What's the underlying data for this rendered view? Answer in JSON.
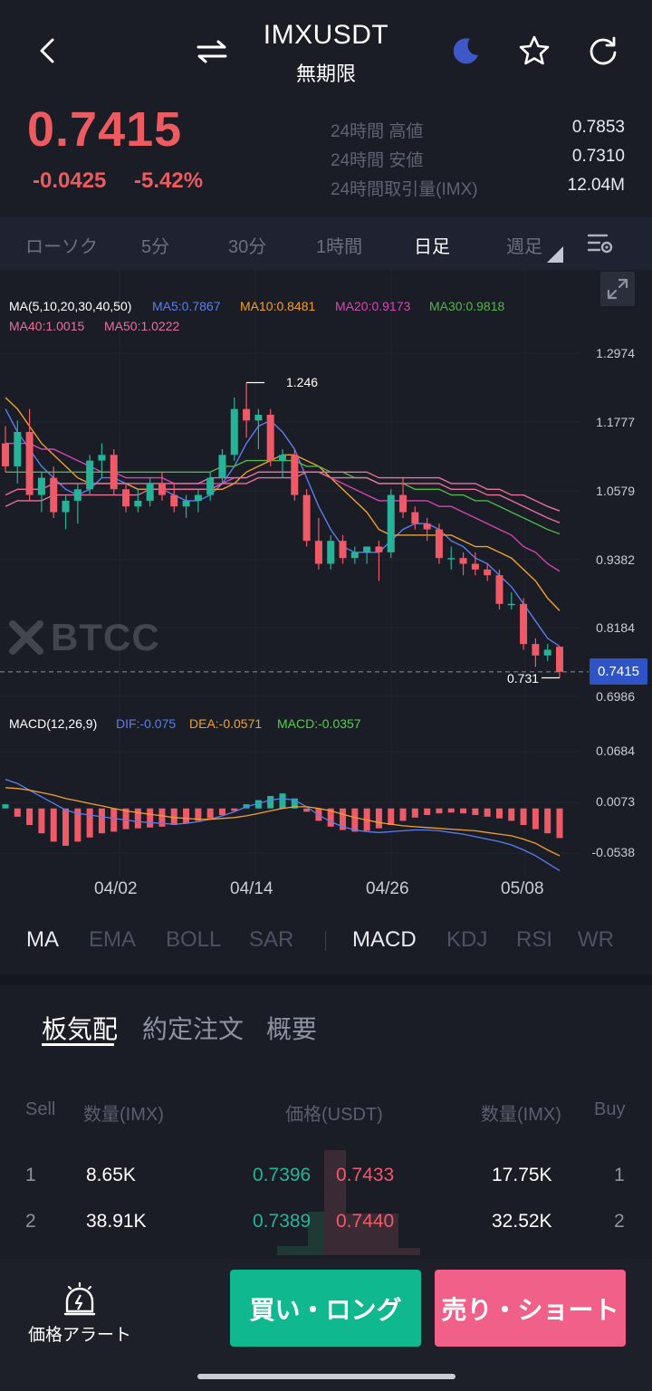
{
  "header": {
    "title": "IMXUSDT",
    "subtitle": "無期限"
  },
  "ticker": {
    "price": "0.7415",
    "change": "-0.0425",
    "change_pct": "-5.42%",
    "stats": [
      {
        "label": "24時間 高値",
        "value": "0.7853"
      },
      {
        "label": "24時間 安値",
        "value": "0.7310"
      },
      {
        "label": "24時間取引量(IMX)",
        "value": "12.04M"
      }
    ]
  },
  "timeframes": [
    "ローソク",
    "5分",
    "30分",
    "1時間",
    "日足",
    "週足"
  ],
  "active_timeframe": "日足",
  "ma_legend": {
    "title": "MA(5,10,20,30,40,50)",
    "items": [
      {
        "label": "MA5:0.7867",
        "color": "#5b7df0"
      },
      {
        "label": "MA10:0.8481",
        "color": "#f0a033"
      },
      {
        "label": "MA20:0.9173",
        "color": "#d645b4"
      },
      {
        "label": "MA30:0.9818",
        "color": "#53b54a"
      },
      {
        "label": "MA40:1.0015",
        "color": "#e8709b"
      },
      {
        "label": "MA50:1.0222",
        "color": "#e8709b"
      }
    ]
  },
  "watermark": "BTCC",
  "price_axis": [
    "1.2974",
    "1.1777",
    "1.0579",
    "0.9382",
    "0.8184",
    "0.6986"
  ],
  "current_price_tag": "0.7415",
  "high_marker": "1.246",
  "low_marker": "0.731",
  "macd_legend": {
    "title": "MACD(12,26,9)",
    "dif": "DIF:-0.075",
    "dea": "DEA:-0.0571",
    "macd": "MACD:-0.0357"
  },
  "macd_axis": [
    "0.0684",
    "0.0073",
    "-0.0538"
  ],
  "date_axis": [
    "04/02",
    "04/14",
    "04/26",
    "05/08"
  ],
  "indicators_main": [
    "MA",
    "EMA",
    "BOLL",
    "SAR"
  ],
  "indicators_sub": [
    "MACD",
    "KDJ",
    "RSI",
    "WR"
  ],
  "orderbook": {
    "tabs": [
      "板気配",
      "約定注文",
      "概要"
    ],
    "headers": {
      "sell": "Sell",
      "qty_left": "数量(IMX)",
      "price": "価格(USDT)",
      "qty_right": "数量(IMX)",
      "buy": "Buy"
    },
    "rows": [
      {
        "idx": "1",
        "bid_qty": "8.65K",
        "bid_price": "0.7396",
        "ask_price": "0.7433",
        "ask_qty": "17.75K",
        "idx_r": "1"
      },
      {
        "idx": "2",
        "bid_qty": "38.91K",
        "bid_price": "0.7389",
        "ask_price": "0.7440",
        "ask_qty": "32.52K",
        "idx_r": "2"
      }
    ]
  },
  "footer": {
    "alert_label": "価格アラート",
    "buy_label": "買い・ロング",
    "sell_label": "売り・ショート"
  },
  "colors": {
    "up": "#26b39a",
    "down": "#ef5a68",
    "buy_button": "#0fb88f",
    "sell_button": "#f06088"
  },
  "chart_data": {
    "type": "candlestick",
    "price_range": [
      0.6986,
      1.2974
    ],
    "candles": [
      [
        1.14,
        1.17,
        1.09,
        1.1
      ],
      [
        1.1,
        1.18,
        1.07,
        1.16
      ],
      [
        1.16,
        1.2,
        1.04,
        1.05
      ],
      [
        1.05,
        1.09,
        1.02,
        1.08
      ],
      [
        1.08,
        1.1,
        1.01,
        1.02
      ],
      [
        1.02,
        1.05,
        0.99,
        1.04
      ],
      [
        1.04,
        1.07,
        1.0,
        1.06
      ],
      [
        1.06,
        1.12,
        1.05,
        1.11
      ],
      [
        1.11,
        1.14,
        1.08,
        1.12
      ],
      [
        1.12,
        1.13,
        1.05,
        1.06
      ],
      [
        1.06,
        1.07,
        1.02,
        1.03
      ],
      [
        1.03,
        1.06,
        1.02,
        1.04
      ],
      [
        1.04,
        1.08,
        1.03,
        1.07
      ],
      [
        1.07,
        1.09,
        1.04,
        1.05
      ],
      [
        1.05,
        1.07,
        1.02,
        1.03
      ],
      [
        1.03,
        1.05,
        1.01,
        1.04
      ],
      [
        1.04,
        1.06,
        1.02,
        1.05
      ],
      [
        1.05,
        1.09,
        1.04,
        1.08
      ],
      [
        1.08,
        1.13,
        1.07,
        1.12
      ],
      [
        1.12,
        1.22,
        1.11,
        1.2
      ],
      [
        1.2,
        1.246,
        1.15,
        1.18
      ],
      [
        1.18,
        1.2,
        1.13,
        1.19
      ],
      [
        1.19,
        1.2,
        1.1,
        1.11
      ],
      [
        1.11,
        1.13,
        1.08,
        1.12
      ],
      [
        1.12,
        1.13,
        1.04,
        1.05
      ],
      [
        1.05,
        1.06,
        0.96,
        0.97
      ],
      [
        0.97,
        1.01,
        0.92,
        0.93
      ],
      [
        0.93,
        0.98,
        0.92,
        0.97
      ],
      [
        0.97,
        0.98,
        0.93,
        0.94
      ],
      [
        0.94,
        0.96,
        0.93,
        0.95
      ],
      [
        0.95,
        0.96,
        0.93,
        0.96
      ],
      [
        0.96,
        0.97,
        0.9,
        0.95
      ],
      [
        0.95,
        1.06,
        0.94,
        1.05
      ],
      [
        1.05,
        1.08,
        1.01,
        1.02
      ],
      [
        1.02,
        1.03,
        0.99,
        1.0
      ],
      [
        1.0,
        1.01,
        0.97,
        0.99
      ],
      [
        0.99,
        1.0,
        0.93,
        0.94
      ],
      [
        0.94,
        0.96,
        0.92,
        0.94
      ],
      [
        0.94,
        0.95,
        0.91,
        0.93
      ],
      [
        0.93,
        0.95,
        0.91,
        0.92
      ],
      [
        0.92,
        0.93,
        0.9,
        0.91
      ],
      [
        0.91,
        0.92,
        0.85,
        0.86
      ],
      [
        0.86,
        0.88,
        0.85,
        0.86
      ],
      [
        0.86,
        0.87,
        0.78,
        0.79
      ],
      [
        0.79,
        0.8,
        0.75,
        0.77
      ],
      [
        0.77,
        0.79,
        0.76,
        0.78
      ],
      [
        0.7853,
        0.7853,
        0.731,
        0.7415
      ]
    ],
    "series": [
      {
        "name": "MA5",
        "values": [
          1.2,
          1.16,
          1.13,
          1.1,
          1.08,
          1.06,
          1.05,
          1.06,
          1.08,
          1.08,
          1.07,
          1.06,
          1.06,
          1.06,
          1.05,
          1.04,
          1.04,
          1.05,
          1.07,
          1.1,
          1.14,
          1.17,
          1.18,
          1.16,
          1.13,
          1.08,
          1.03,
          0.99,
          0.96,
          0.95,
          0.95,
          0.95,
          0.97,
          0.99,
          1.0,
          1.0,
          0.99,
          0.97,
          0.96,
          0.94,
          0.93,
          0.91,
          0.89,
          0.86,
          0.83,
          0.8,
          0.786
        ]
      },
      {
        "name": "MA10",
        "values": [
          1.22,
          1.2,
          1.17,
          1.14,
          1.12,
          1.1,
          1.08,
          1.07,
          1.07,
          1.07,
          1.07,
          1.06,
          1.06,
          1.06,
          1.06,
          1.06,
          1.06,
          1.06,
          1.06,
          1.07,
          1.09,
          1.1,
          1.11,
          1.12,
          1.12,
          1.11,
          1.1,
          1.08,
          1.06,
          1.04,
          1.02,
          0.99,
          0.98,
          0.98,
          0.98,
          0.98,
          0.98,
          0.98,
          0.97,
          0.96,
          0.96,
          0.95,
          0.94,
          0.92,
          0.9,
          0.87,
          0.848
        ]
      },
      {
        "name": "MA20",
        "values": [
          1.14,
          1.14,
          1.14,
          1.13,
          1.13,
          1.12,
          1.11,
          1.1,
          1.09,
          1.09,
          1.08,
          1.08,
          1.08,
          1.08,
          1.07,
          1.07,
          1.07,
          1.07,
          1.07,
          1.08,
          1.08,
          1.09,
          1.09,
          1.09,
          1.09,
          1.09,
          1.09,
          1.08,
          1.07,
          1.06,
          1.05,
          1.04,
          1.04,
          1.04,
          1.04,
          1.04,
          1.03,
          1.03,
          1.02,
          1.01,
          1.0,
          0.99,
          0.98,
          0.96,
          0.95,
          0.93,
          0.917
        ]
      },
      {
        "name": "MA30",
        "values": [
          1.09,
          1.09,
          1.09,
          1.09,
          1.09,
          1.09,
          1.09,
          1.09,
          1.09,
          1.09,
          1.09,
          1.09,
          1.09,
          1.09,
          1.09,
          1.09,
          1.09,
          1.09,
          1.1,
          1.1,
          1.11,
          1.11,
          1.11,
          1.11,
          1.11,
          1.1,
          1.1,
          1.09,
          1.09,
          1.08,
          1.08,
          1.07,
          1.07,
          1.07,
          1.06,
          1.06,
          1.06,
          1.05,
          1.05,
          1.04,
          1.04,
          1.03,
          1.02,
          1.01,
          1.0,
          0.99,
          0.982
        ]
      },
      {
        "name": "MA40",
        "values": [
          1.05,
          1.06,
          1.06,
          1.06,
          1.07,
          1.07,
          1.07,
          1.07,
          1.07,
          1.07,
          1.07,
          1.07,
          1.07,
          1.07,
          1.07,
          1.07,
          1.07,
          1.08,
          1.08,
          1.08,
          1.08,
          1.09,
          1.09,
          1.09,
          1.09,
          1.09,
          1.09,
          1.08,
          1.08,
          1.08,
          1.08,
          1.07,
          1.07,
          1.07,
          1.07,
          1.07,
          1.07,
          1.06,
          1.06,
          1.06,
          1.05,
          1.05,
          1.04,
          1.03,
          1.02,
          1.01,
          1.0015
        ]
      },
      {
        "name": "MA50",
        "values": [
          1.03,
          1.04,
          1.04,
          1.04,
          1.05,
          1.05,
          1.05,
          1.05,
          1.05,
          1.05,
          1.05,
          1.05,
          1.06,
          1.06,
          1.06,
          1.06,
          1.06,
          1.06,
          1.07,
          1.07,
          1.07,
          1.08,
          1.08,
          1.08,
          1.08,
          1.09,
          1.09,
          1.09,
          1.09,
          1.09,
          1.09,
          1.08,
          1.08,
          1.08,
          1.08,
          1.08,
          1.08,
          1.07,
          1.07,
          1.07,
          1.06,
          1.06,
          1.05,
          1.05,
          1.04,
          1.03,
          1.0222
        ]
      }
    ],
    "macd": {
      "range": [
        -0.0538,
        0.0684
      ],
      "hist": [
        0.005,
        -0.01,
        -0.02,
        -0.03,
        -0.04,
        -0.045,
        -0.04,
        -0.035,
        -0.03,
        -0.028,
        -0.025,
        -0.024,
        -0.023,
        -0.022,
        -0.02,
        -0.018,
        -0.015,
        -0.012,
        -0.008,
        -0.003,
        0.005,
        0.01,
        0.015,
        0.018,
        0.012,
        -0.004,
        -0.015,
        -0.022,
        -0.026,
        -0.028,
        -0.027,
        -0.024,
        -0.02,
        -0.015,
        -0.011,
        -0.008,
        -0.006,
        -0.005,
        -0.006,
        -0.008,
        -0.01,
        -0.012,
        -0.015,
        -0.02,
        -0.025,
        -0.03,
        -0.0357
      ],
      "dif": [
        0.035,
        0.03,
        0.022,
        0.014,
        0.006,
        -0.002,
        -0.006,
        -0.008,
        -0.01,
        -0.012,
        -0.014,
        -0.016,
        -0.017,
        -0.018,
        -0.019,
        -0.018,
        -0.016,
        -0.013,
        -0.009,
        -0.004,
        0.002,
        0.006,
        0.01,
        0.012,
        0.01,
        0.002,
        -0.008,
        -0.016,
        -0.022,
        -0.026,
        -0.028,
        -0.029,
        -0.028,
        -0.027,
        -0.026,
        -0.026,
        -0.027,
        -0.029,
        -0.031,
        -0.034,
        -0.037,
        -0.04,
        -0.044,
        -0.05,
        -0.057,
        -0.066,
        -0.075
      ],
      "dea": [
        0.025,
        0.024,
        0.022,
        0.019,
        0.016,
        0.012,
        0.009,
        0.006,
        0.003,
        0.0,
        -0.003,
        -0.005,
        -0.007,
        -0.009,
        -0.011,
        -0.012,
        -0.013,
        -0.013,
        -0.012,
        -0.011,
        -0.009,
        -0.006,
        -0.003,
        0.0,
        0.002,
        0.002,
        0.0,
        -0.003,
        -0.007,
        -0.011,
        -0.014,
        -0.017,
        -0.019,
        -0.021,
        -0.022,
        -0.023,
        -0.024,
        -0.025,
        -0.026,
        -0.027,
        -0.029,
        -0.031,
        -0.033,
        -0.037,
        -0.042,
        -0.05,
        -0.0571
      ]
    }
  }
}
